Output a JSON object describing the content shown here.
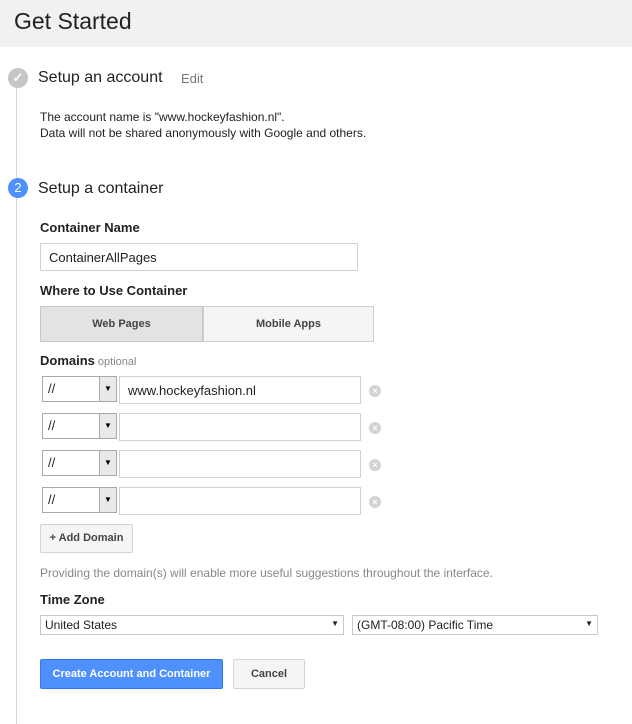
{
  "header": {
    "title": "Get Started"
  },
  "step1": {
    "title": "Setup an account",
    "edit_label": "Edit",
    "check_symbol": "✓",
    "line1": "The account name is \"www.hockeyfashion.nl\".",
    "line2": "Data will not be shared anonymously with Google and others."
  },
  "step2": {
    "number": "2",
    "title": "Setup a container",
    "container_name_label": "Container Name",
    "container_name_value": "ContainerAllPages",
    "where_label": "Where to Use Container",
    "where_options": [
      "Web Pages",
      "Mobile Apps"
    ],
    "where_selected": "Web Pages",
    "domains_label": "Domains",
    "domains_optional": "optional",
    "domains": [
      {
        "protocol": "//",
        "value": "www.hockeyfashion.nl"
      },
      {
        "protocol": "//",
        "value": ""
      },
      {
        "protocol": "//",
        "value": ""
      },
      {
        "protocol": "//",
        "value": ""
      }
    ],
    "add_domain_label": "+ Add Domain",
    "hint": "Providing the domain(s) will enable more useful suggestions throughout the interface.",
    "timezone_label": "Time Zone",
    "country": "United States",
    "timezone": "(GMT-08:00) Pacific Time",
    "create_label": "Create Account and Container",
    "cancel_label": "Cancel"
  },
  "colors": {
    "accent": "#4d90fe",
    "header_bg": "#f1f1f1",
    "muted": "#888888"
  },
  "icons": {
    "step_done": "check-icon",
    "remove": "remove-x-icon",
    "dropdown": "chevron-down-icon"
  }
}
